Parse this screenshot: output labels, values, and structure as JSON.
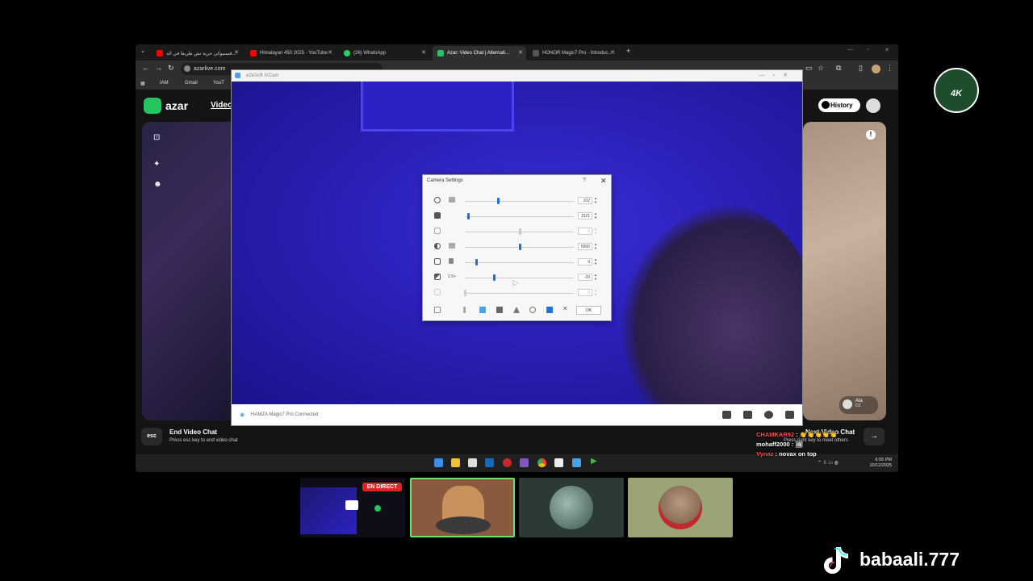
{
  "browser": {
    "tabs": [
      {
        "label": "قسنيوكي حرية تش طريقا في الد...",
        "fav_color": "#ff0000"
      },
      {
        "label": "Himalayan 450 2025 - YouTube",
        "fav_color": "#ff0000"
      },
      {
        "label": "(26) WhatsApp",
        "fav_color": "#25d366"
      },
      {
        "label": "Azar: Video Chat | Alternati...",
        "fav_color": "#22c55e"
      },
      {
        "label": "HONOR Magic7 Pro - Introduc...",
        "fav_color": "#555555"
      }
    ],
    "url": "azarlive.com",
    "bookmarks": [
      "IAM",
      "Gmail",
      "YouT"
    ]
  },
  "azar": {
    "logo_text": "azar",
    "video_tab": "Video",
    "history_label": "History",
    "partner_name": "Ala",
    "partner_country": "DZ",
    "esc_key": "esc",
    "end_title": "End Video Chat",
    "end_sub": "Press esc key to end video chat",
    "next_title": "Next Video Chat",
    "next_sub": "Press right key to meet others",
    "next_arrow": "→"
  },
  "camera_app": {
    "title": "e2eSoft iVCam",
    "status": "HAMZA Magic7 Pro   Connected"
  },
  "settings_dialog": {
    "title": "Camera Settings",
    "help": "?",
    "close": "✕",
    "ok_label": "OK",
    "rows": [
      {
        "value": "102",
        "level": 0.3,
        "disabled": false,
        "label": ""
      },
      {
        "value": "1521",
        "level": 0.03,
        "disabled": false,
        "label": ""
      },
      {
        "value": "0",
        "level": 0.5,
        "disabled": true,
        "label": ""
      },
      {
        "value": "5000",
        "level": 0.5,
        "disabled": false,
        "label": ""
      },
      {
        "value": "9",
        "level": 0.1,
        "disabled": false,
        "label": ""
      },
      {
        "value": "-29",
        "level": 0.27,
        "disabled": false,
        "label": "2.9+"
      },
      {
        "value": "0",
        "level": 0.0,
        "disabled": true,
        "label": ""
      }
    ]
  },
  "taskbar": {
    "time": "6:56 PM",
    "date": "10/12/2025"
  },
  "stream": {
    "live_badge": "EN DIRECT",
    "chat": [
      {
        "user": "CHAMKAR92",
        "msg": ": 👏👏👏👏👏"
      },
      {
        "user": "mohaff2000",
        "msg": ": 🖼"
      },
      {
        "user": "Vynaz",
        "msg": ": novax on top"
      }
    ],
    "handle": "babaali.777",
    "badge": "4K"
  }
}
